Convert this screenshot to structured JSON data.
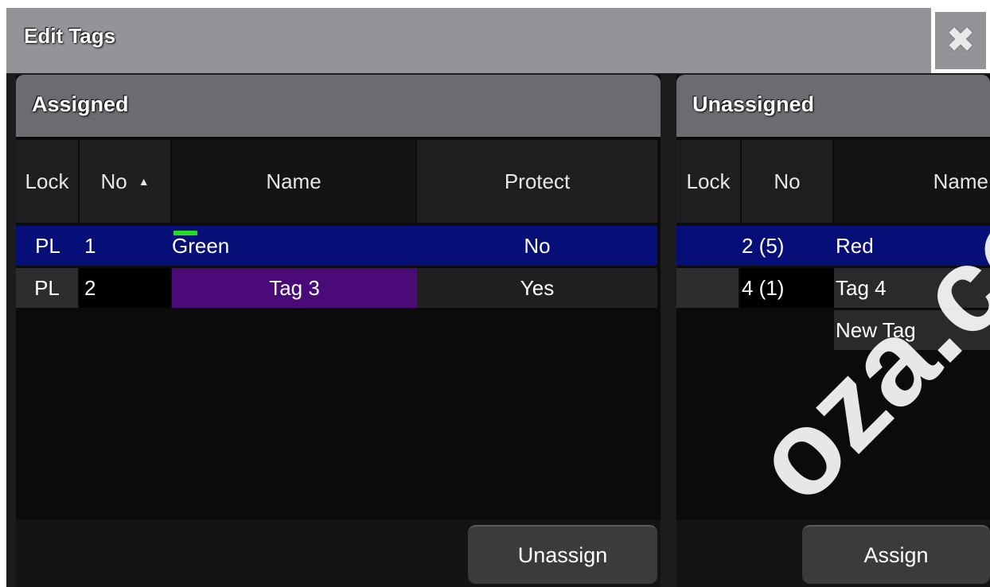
{
  "window": {
    "title": "Edit Tags",
    "close_icon": "close-icon"
  },
  "assigned": {
    "title": "Assigned",
    "columns": {
      "lock": "Lock",
      "no": "No",
      "name": "Name",
      "protect": "Protect"
    },
    "sort_indicator": "▲",
    "rows": [
      {
        "lock": "PL",
        "no": "1",
        "name": "Green",
        "protect": "No",
        "selected": true
      },
      {
        "lock": "PL",
        "no": "2",
        "name": "Tag 3",
        "protect": "Yes",
        "selected": false
      }
    ],
    "button": "Unassign"
  },
  "unassigned": {
    "title": "Unassigned",
    "columns": {
      "lock": "Lock",
      "no": "No",
      "name": "Name"
    },
    "rows": [
      {
        "lock": "",
        "no": "2 (5)",
        "name": "Red",
        "selected": true
      },
      {
        "lock": "",
        "no": "4 (1)",
        "name": "Tag 4",
        "selected": false
      },
      {
        "lock": "",
        "no": "",
        "name": "New Tag",
        "selected": false
      }
    ],
    "button": "Assign"
  },
  "colors": {
    "selected_row": "#060f78",
    "tag3_bg": "#4a0a78",
    "green_indicator": "#22dd22",
    "titlebar": "#939398"
  },
  "watermark": "oza.com"
}
